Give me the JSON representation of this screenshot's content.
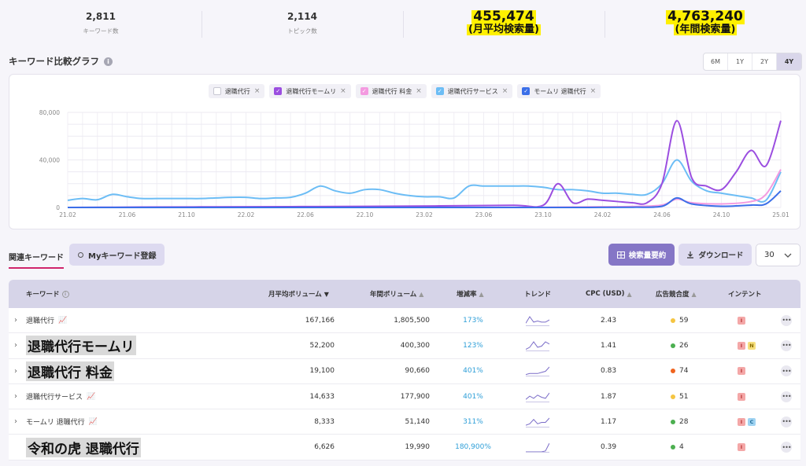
{
  "stats": [
    {
      "value": "2,811",
      "label": "キーワード数"
    },
    {
      "value": "2,114",
      "label": "トピック数"
    },
    {
      "value": "455,474",
      "label": "(月平均検索量)"
    },
    {
      "value": "4,763,240",
      "label": "(年間検索量)"
    }
  ],
  "section": {
    "title": "キーワード比較グラフ",
    "info_icon": "info-icon"
  },
  "ranges": [
    "6M",
    "1Y",
    "2Y",
    "4Y"
  ],
  "active_range": "4Y",
  "legend": [
    {
      "label": "退職代行",
      "checked": false,
      "color": "#c8c8d2"
    },
    {
      "label": "退職代行モームリ",
      "checked": true,
      "color": "#9b4ee0"
    },
    {
      "label": "退職代行 料金",
      "checked": true,
      "color": "#f49ae0"
    },
    {
      "label": "退職代行サービス",
      "checked": true,
      "color": "#6cbdf5"
    },
    {
      "label": "モームリ 退職代行",
      "checked": true,
      "color": "#3b6fe8"
    }
  ],
  "chart_data": {
    "type": "line",
    "ylim": [
      0,
      80000
    ],
    "y_ticks": [
      "0",
      "40,000",
      "80,000"
    ],
    "x_ticks": [
      "21.02",
      "21.06",
      "21.10",
      "22.02",
      "22.06",
      "22.10",
      "23.02",
      "23.06",
      "23.10",
      "24.02",
      "24.06",
      "24.10",
      "25.01"
    ],
    "grid": true,
    "series": [
      {
        "name": "退職代行サービス",
        "color": "#6cbdf5",
        "x": [
          0,
          1,
          2,
          3,
          4,
          5,
          6,
          7,
          8,
          9,
          10,
          11,
          12,
          13,
          14,
          15,
          16,
          17,
          18,
          19,
          20,
          21,
          22,
          23,
          24,
          25,
          26,
          27,
          28,
          29,
          30,
          31,
          32,
          33,
          34,
          35,
          36,
          37,
          38,
          39,
          40,
          41,
          42,
          43,
          44,
          45,
          46,
          47,
          48
        ],
        "y": [
          6000,
          7500,
          6500,
          11000,
          9000,
          7500,
          7500,
          7500,
          7500,
          7500,
          8000,
          8500,
          8500,
          7500,
          8000,
          8500,
          12000,
          18000,
          14000,
          12000,
          15000,
          15000,
          12000,
          10000,
          9000,
          9000,
          8000,
          18000,
          18000,
          18000,
          18000,
          18000,
          17000,
          15000,
          15000,
          14000,
          12000,
          12000,
          11000,
          11000,
          20000,
          40000,
          22000,
          14000,
          12000,
          10000,
          8000,
          6000,
          30000
        ]
      },
      {
        "name": "退職代行モームリ",
        "color": "#9b4ee0",
        "x": [
          0,
          5,
          10,
          15,
          20,
          25,
          30,
          32,
          33,
          34,
          35,
          36,
          37,
          38,
          39,
          40,
          41,
          42,
          43,
          44,
          45,
          46,
          47,
          48
        ],
        "y": [
          0,
          300,
          500,
          700,
          900,
          1300,
          1800,
          1800,
          20000,
          4000,
          7000,
          6000,
          5000,
          4000,
          4000,
          20000,
          73000,
          25000,
          18000,
          15000,
          30000,
          48000,
          35000,
          73000
        ]
      },
      {
        "name": "退職代行 料金",
        "color": "#f49ae0",
        "x": [
          0,
          10,
          20,
          30,
          35,
          38,
          40,
          41,
          42,
          44,
          46,
          47,
          48
        ],
        "y": [
          0,
          0,
          0,
          0,
          500,
          800,
          2000,
          7000,
          4000,
          3000,
          5000,
          11000,
          32000
        ]
      },
      {
        "name": "モームリ 退職代行",
        "color": "#3b6fe8",
        "x": [
          0,
          10,
          20,
          30,
          35,
          38,
          40,
          41,
          42,
          44,
          46,
          47,
          48
        ],
        "y": [
          0,
          0,
          0,
          0,
          0,
          200,
          1000,
          8000,
          3000,
          1000,
          2000,
          3000,
          14000
        ]
      }
    ]
  },
  "tabs": {
    "related": "関連キーワード",
    "my_keyword": "Myキーワード登録"
  },
  "buttons": {
    "summary": "検索量要約",
    "download": "ダウンロード",
    "page_size": "30"
  },
  "table": {
    "headers": [
      "キーワード",
      "月平均ボリューム",
      "年間ボリューム",
      "増減率",
      "トレンド",
      "CPC (USD)",
      "広告競合度",
      "インテント"
    ],
    "rows": [
      {
        "keyword": "退職代行",
        "big": false,
        "trend_icon": true,
        "monthly": "167,166",
        "yearly": "1,805,500",
        "rate": "173%",
        "cpc": "2.43",
        "comp": "59",
        "comp_color": "#f5c542",
        "intents": [
          "I"
        ],
        "spark": [
          2,
          8,
          3,
          4,
          3,
          3,
          5
        ],
        "chevron": true
      },
      {
        "keyword": "退職代行モームリ",
        "big": true,
        "trend_icon": false,
        "monthly": "52,200",
        "yearly": "400,300",
        "rate": "123%",
        "cpc": "1.41",
        "comp": "26",
        "comp_color": "#4caf50",
        "intents": [
          "I",
          "N"
        ],
        "spark": [
          1,
          3,
          8,
          3,
          4,
          8,
          6
        ],
        "chevron": true
      },
      {
        "keyword": "退職代行 料金",
        "big": true,
        "trend_icon": false,
        "monthly": "19,100",
        "yearly": "90,660",
        "rate": "401%",
        "cpc": "0.83",
        "comp": "74",
        "comp_color": "#f0641e",
        "intents": [
          "I"
        ],
        "spark": [
          1,
          2,
          2,
          2,
          3,
          4,
          8
        ],
        "chevron": true
      },
      {
        "keyword": "退職代行サービス",
        "big": false,
        "trend_icon": true,
        "monthly": "14,633",
        "yearly": "177,900",
        "rate": "401%",
        "cpc": "1.87",
        "comp": "51",
        "comp_color": "#f5c542",
        "intents": [
          "I"
        ],
        "spark": [
          2,
          5,
          3,
          6,
          4,
          3,
          8
        ],
        "chevron": true
      },
      {
        "keyword": "モームリ 退職代行",
        "big": false,
        "trend_icon": true,
        "monthly": "8,333",
        "yearly": "51,140",
        "rate": "311%",
        "cpc": "1.17",
        "comp": "28",
        "comp_color": "#4caf50",
        "intents": [
          "I",
          "C"
        ],
        "spark": [
          1,
          2,
          5,
          2,
          3,
          3,
          6
        ],
        "chevron": true
      },
      {
        "keyword": "令和の虎 退職代行",
        "big": true,
        "trend_icon": false,
        "monthly": "6,626",
        "yearly": "19,990",
        "rate": "180,900%",
        "cpc": "0.39",
        "comp": "4",
        "comp_color": "#4caf50",
        "intents": [
          "I"
        ],
        "spark": [
          0,
          0,
          0,
          0,
          0,
          1,
          9
        ],
        "chevron": false
      }
    ]
  }
}
